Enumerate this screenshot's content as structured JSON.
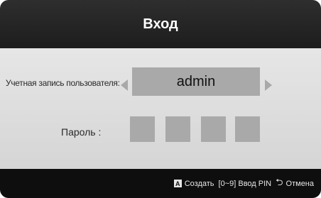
{
  "dialog": {
    "title": "Вход"
  },
  "account": {
    "label": "Учетная запись пользователя:",
    "value": "admin"
  },
  "password": {
    "label": "Пароль :",
    "pin_count": 4
  },
  "footer": {
    "create_key": "A",
    "create_label": "Создать",
    "pin_label": "[0~9] Ввод PIN",
    "cancel_label": "Отмена"
  },
  "colors": {
    "header": "#222222",
    "body": "#dddddd",
    "field": "#a9a9a9",
    "footer": "#0e0e0e"
  },
  "icons": {
    "left": "arrow-left-icon",
    "right": "arrow-right-icon",
    "return": "return-icon"
  }
}
